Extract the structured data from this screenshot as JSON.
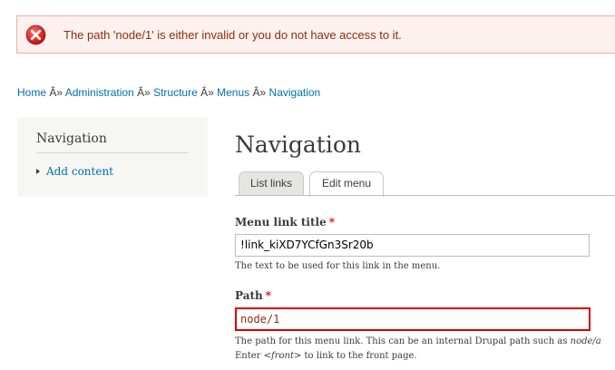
{
  "message": {
    "text": "The path 'node/1' is either invalid or you do not have access to it.",
    "icon": "error-icon",
    "colors": {
      "text": "#8c2e0b",
      "background": "#fcf1ef",
      "border": "#e8b3a5",
      "icon": "#d21e1e"
    }
  },
  "breadcrumb": {
    "items": [
      "Home",
      "Administration",
      "Structure",
      "Menus",
      "Navigation"
    ],
    "separator": " Â» "
  },
  "sidebar": {
    "title": "Navigation",
    "items": [
      {
        "label": "Add content"
      }
    ]
  },
  "page": {
    "title": "Navigation",
    "tabs": [
      {
        "label": "List links",
        "active": false
      },
      {
        "label": "Edit menu",
        "active": true
      }
    ]
  },
  "form": {
    "link_title": {
      "label": "Menu link title",
      "required_mark": "*",
      "value": "!link_kiXD7YCfGn3Sr20b",
      "description": "The text to be used for this link in the menu."
    },
    "path": {
      "label": "Path",
      "required_mark": "*",
      "value": "node/1",
      "description_line1_prefix": "The path for this menu link. This can be an internal Drupal path such as ",
      "description_line1_em": "node/a",
      "description_line2_prefix": "Enter ",
      "description_line2_em": "<front>",
      "description_line2_suffix": " to link to the front page."
    }
  },
  "colors": {
    "link": "#0071b3",
    "required": "#e40000",
    "error_border": "#d90000"
  }
}
